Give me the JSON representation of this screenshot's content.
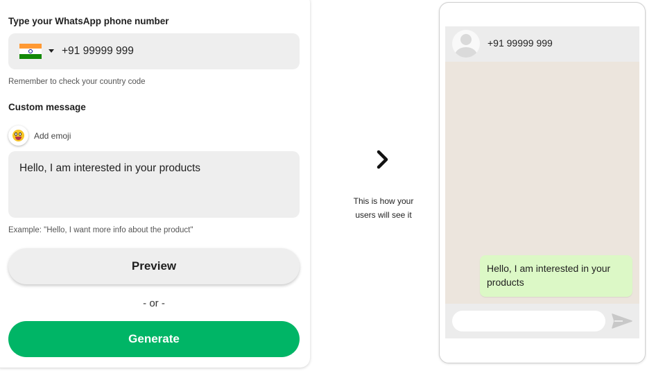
{
  "form": {
    "phone_label": "Type your WhatsApp phone number",
    "country": {
      "flag_icon": "india-flag-icon",
      "dropdown_icon": "caret-down-icon"
    },
    "phone_value": "+91 99999 999",
    "phone_hint": "Remember to check your country code",
    "message_label": "Custom message",
    "emoji_icon": "emoji-face-icon",
    "add_emoji_label": "Add emoji",
    "message_value": "Hello, I am interested in your products",
    "message_example": "Example: \"Hello, I want more info about the product\"",
    "preview_label": "Preview",
    "or_label": "- or -",
    "generate_label": "Generate"
  },
  "middle": {
    "arrow_icon": "chevron-right-icon",
    "caption_line1": "This is how your",
    "caption_line2": "users will see it"
  },
  "phone_preview": {
    "contact_name": "+91 99999 999",
    "avatar_icon": "default-avatar-icon",
    "message_bubble": "Hello, I am interested in your products",
    "send_icon": "send-icon"
  },
  "colors": {
    "generate_green": "#00b566",
    "bubble_green": "#dcf8c6",
    "chat_background": "#ece5dd",
    "field_gray": "#eeeeee"
  }
}
